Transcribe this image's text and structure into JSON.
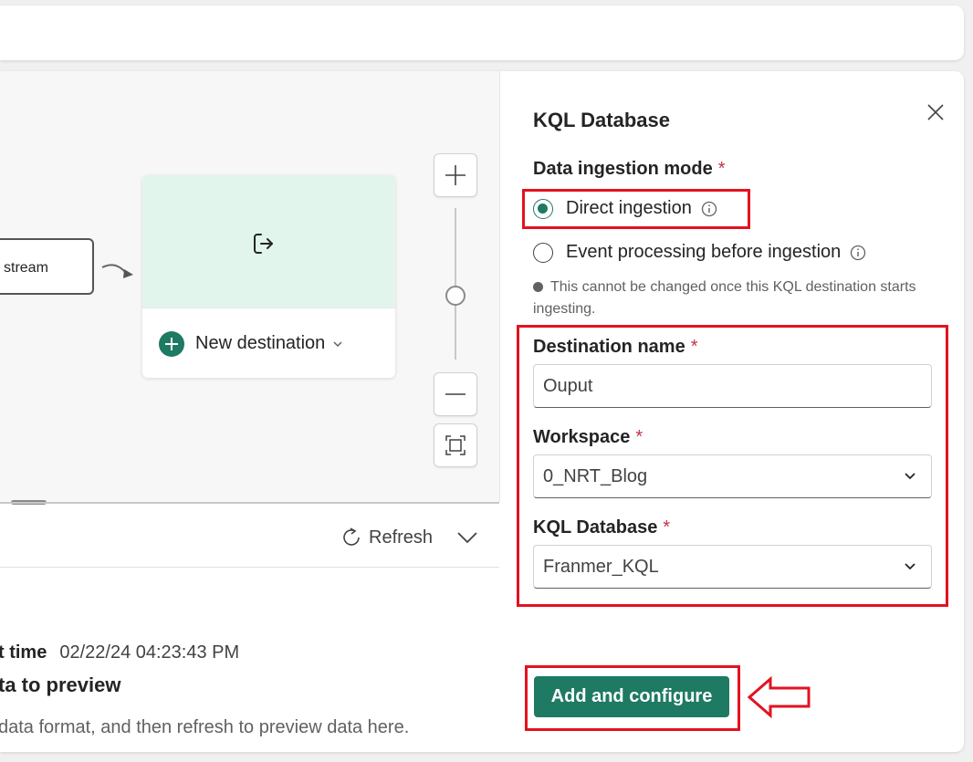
{
  "canvas": {
    "stream_node_label": "stream",
    "destination_card": {
      "add_label": "New destination",
      "exit_icon": "sign-out-icon",
      "header_color": "#e1f5ec"
    },
    "zoom_in_icon": "plus-icon",
    "zoom_out_icon": "minus-icon",
    "fit_icon": "fit-to-screen-icon"
  },
  "lower_pane": {
    "refresh_label": "Refresh",
    "time_label": "t time",
    "time_value": "02/22/24 04:23:43 PM",
    "nodata_title": "ta to preview",
    "nodata_text": "data format, and then refresh to preview data here."
  },
  "panel": {
    "title": "KQL Database",
    "ingestion_mode_label": "Data ingestion mode",
    "required_mark": "*",
    "options": [
      {
        "label": "Direct ingestion",
        "checked": true
      },
      {
        "label": "Event processing before ingestion",
        "checked": false
      }
    ],
    "note": "This cannot be changed once this KQL destination starts ingesting.",
    "destination_name_label": "Destination name",
    "destination_name_value": "Ouput",
    "workspace_label": "Workspace",
    "workspace_value": "0_NRT_Blog",
    "kql_database_label": "KQL Database",
    "kql_database_value": "Franmer_KQL",
    "add_button_label": "Add and configure"
  },
  "colors": {
    "accent": "#1f7a63",
    "annotation": "#e3121f",
    "required": "#c4314b"
  }
}
